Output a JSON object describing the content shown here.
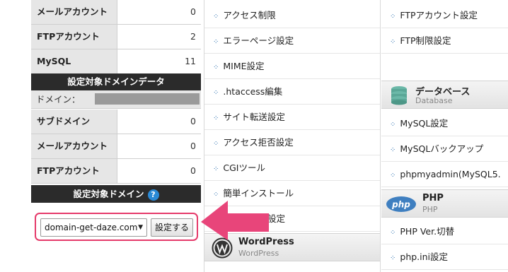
{
  "left_panel": {
    "stats_top": [
      {
        "label": "メールアカウント",
        "value": "0"
      },
      {
        "label": "FTPアカウント",
        "value": "2"
      },
      {
        "label": "MySQL",
        "value": "11"
      }
    ],
    "domain_data_header": "設定対象ドメインデータ",
    "domain_label": "ドメイン：",
    "stats_domain": [
      {
        "label": "サブドメイン",
        "value": "0"
      },
      {
        "label": "メールアカウント",
        "value": "0"
      },
      {
        "label": "FTPアカウント",
        "value": "0"
      }
    ],
    "target_domain_header": "設定対象ドメイン",
    "help_glyph": "?",
    "domain_select_value": "domain-get-daze.com",
    "set_button_label": "設定する"
  },
  "middle_column": {
    "items": [
      "アクセス制限",
      "エラーページ設定",
      "MIME設定",
      ".htaccess編集",
      "サイト転送設定",
      "アクセス拒否設定",
      "CGIツール",
      "簡単インストール",
      "ント設定"
    ],
    "wordpress_section": {
      "title": "WordPress",
      "subtitle": "WordPress"
    }
  },
  "right_column": {
    "items_top": [
      "FTPアカウント設定",
      "FTP制限設定"
    ],
    "database_section": {
      "title": "データベース",
      "subtitle": "Database"
    },
    "items_db": [
      "MySQL設定",
      "MySQLバックアップ",
      "phpmyadmin(MySQL5."
    ],
    "php_section": {
      "title": "PHP",
      "subtitle": "PHP",
      "logo_text": "php"
    },
    "items_php": [
      "PHP Ver.切替",
      "php.ini設定"
    ]
  },
  "colors": {
    "highlight_border": "#e53a6a",
    "arrow": "#e8457a",
    "dark_header": "#2b2b2b",
    "help_icon": "#2a8ad6"
  }
}
